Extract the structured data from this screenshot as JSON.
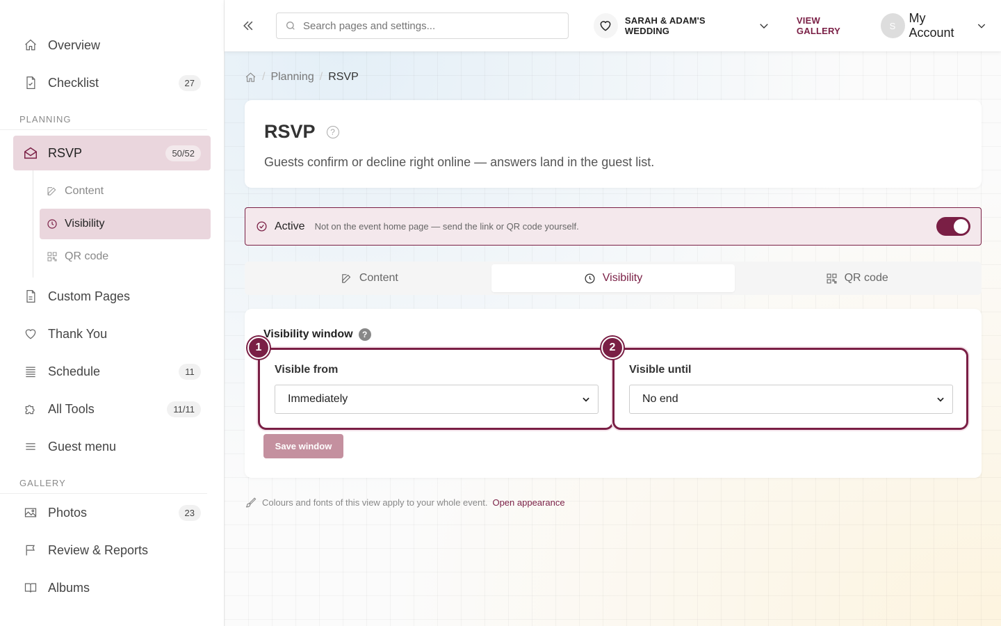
{
  "sidebar": {
    "top_items": [
      {
        "label": "Overview",
        "icon": "home-icon"
      },
      {
        "label": "Checklist",
        "icon": "document-check-icon",
        "badge": "27"
      }
    ],
    "planning_label": "PLANNING",
    "rsvp": {
      "label": "RSVP",
      "badge": "50/52",
      "icon": "envelope-open-icon"
    },
    "rsvp_sub": [
      {
        "label": "Content",
        "icon": "edit-icon"
      },
      {
        "label": "Visibility",
        "icon": "clock-icon"
      },
      {
        "label": "QR code",
        "icon": "qr-code-icon"
      }
    ],
    "planning_items": [
      {
        "label": "Custom Pages",
        "icon": "document-icon"
      },
      {
        "label": "Thank You",
        "icon": "heart-icon"
      },
      {
        "label": "Schedule",
        "icon": "list-icon",
        "badge": "11"
      },
      {
        "label": "All Tools",
        "icon": "puzzle-icon",
        "badge": "11/11"
      },
      {
        "label": "Guest menu",
        "icon": "menu-icon"
      }
    ],
    "gallery_label": "GALLERY",
    "gallery_items": [
      {
        "label": "Photos",
        "icon": "image-icon",
        "badge": "23"
      },
      {
        "label": "Review & Reports",
        "icon": "flag-icon"
      },
      {
        "label": "Albums",
        "icon": "book-icon"
      }
    ]
  },
  "topbar": {
    "search_placeholder": "Search pages and settings...",
    "event_name": "SARAH & ADAM'S WEDDING",
    "view_gallery": "VIEW GALLERY",
    "avatar_initial": "S",
    "account_label": "My Account"
  },
  "breadcrumb": {
    "parent": "Planning",
    "current": "RSVP",
    "separator": "/"
  },
  "header": {
    "title": "RSVP",
    "help": "?",
    "description": "Guests confirm or decline right online — answers land in the guest list."
  },
  "status": {
    "label": "Active",
    "note": "Not on the event home page — send the link or QR code yourself.",
    "enabled": true
  },
  "tabs": [
    {
      "label": "Content",
      "icon": "edit-icon"
    },
    {
      "label": "Visibility",
      "icon": "clock-icon",
      "active": true
    },
    {
      "label": "QR code",
      "icon": "qr-code-icon"
    }
  ],
  "visibility": {
    "title": "Visibility window",
    "help": "?",
    "from_label": "Visible from",
    "from_value": "Immediately",
    "until_label": "Visible until",
    "until_value": "No end",
    "marker_1": "1",
    "marker_2": "2",
    "save_label": "Save window"
  },
  "footnote": {
    "text": "Colours and fonts of this view apply to your whole event.",
    "link": "Open appearance"
  },
  "colors": {
    "accent": "#7a1f45",
    "accent_soft": "#ead6dd",
    "save_disabled": "#c4909f"
  }
}
